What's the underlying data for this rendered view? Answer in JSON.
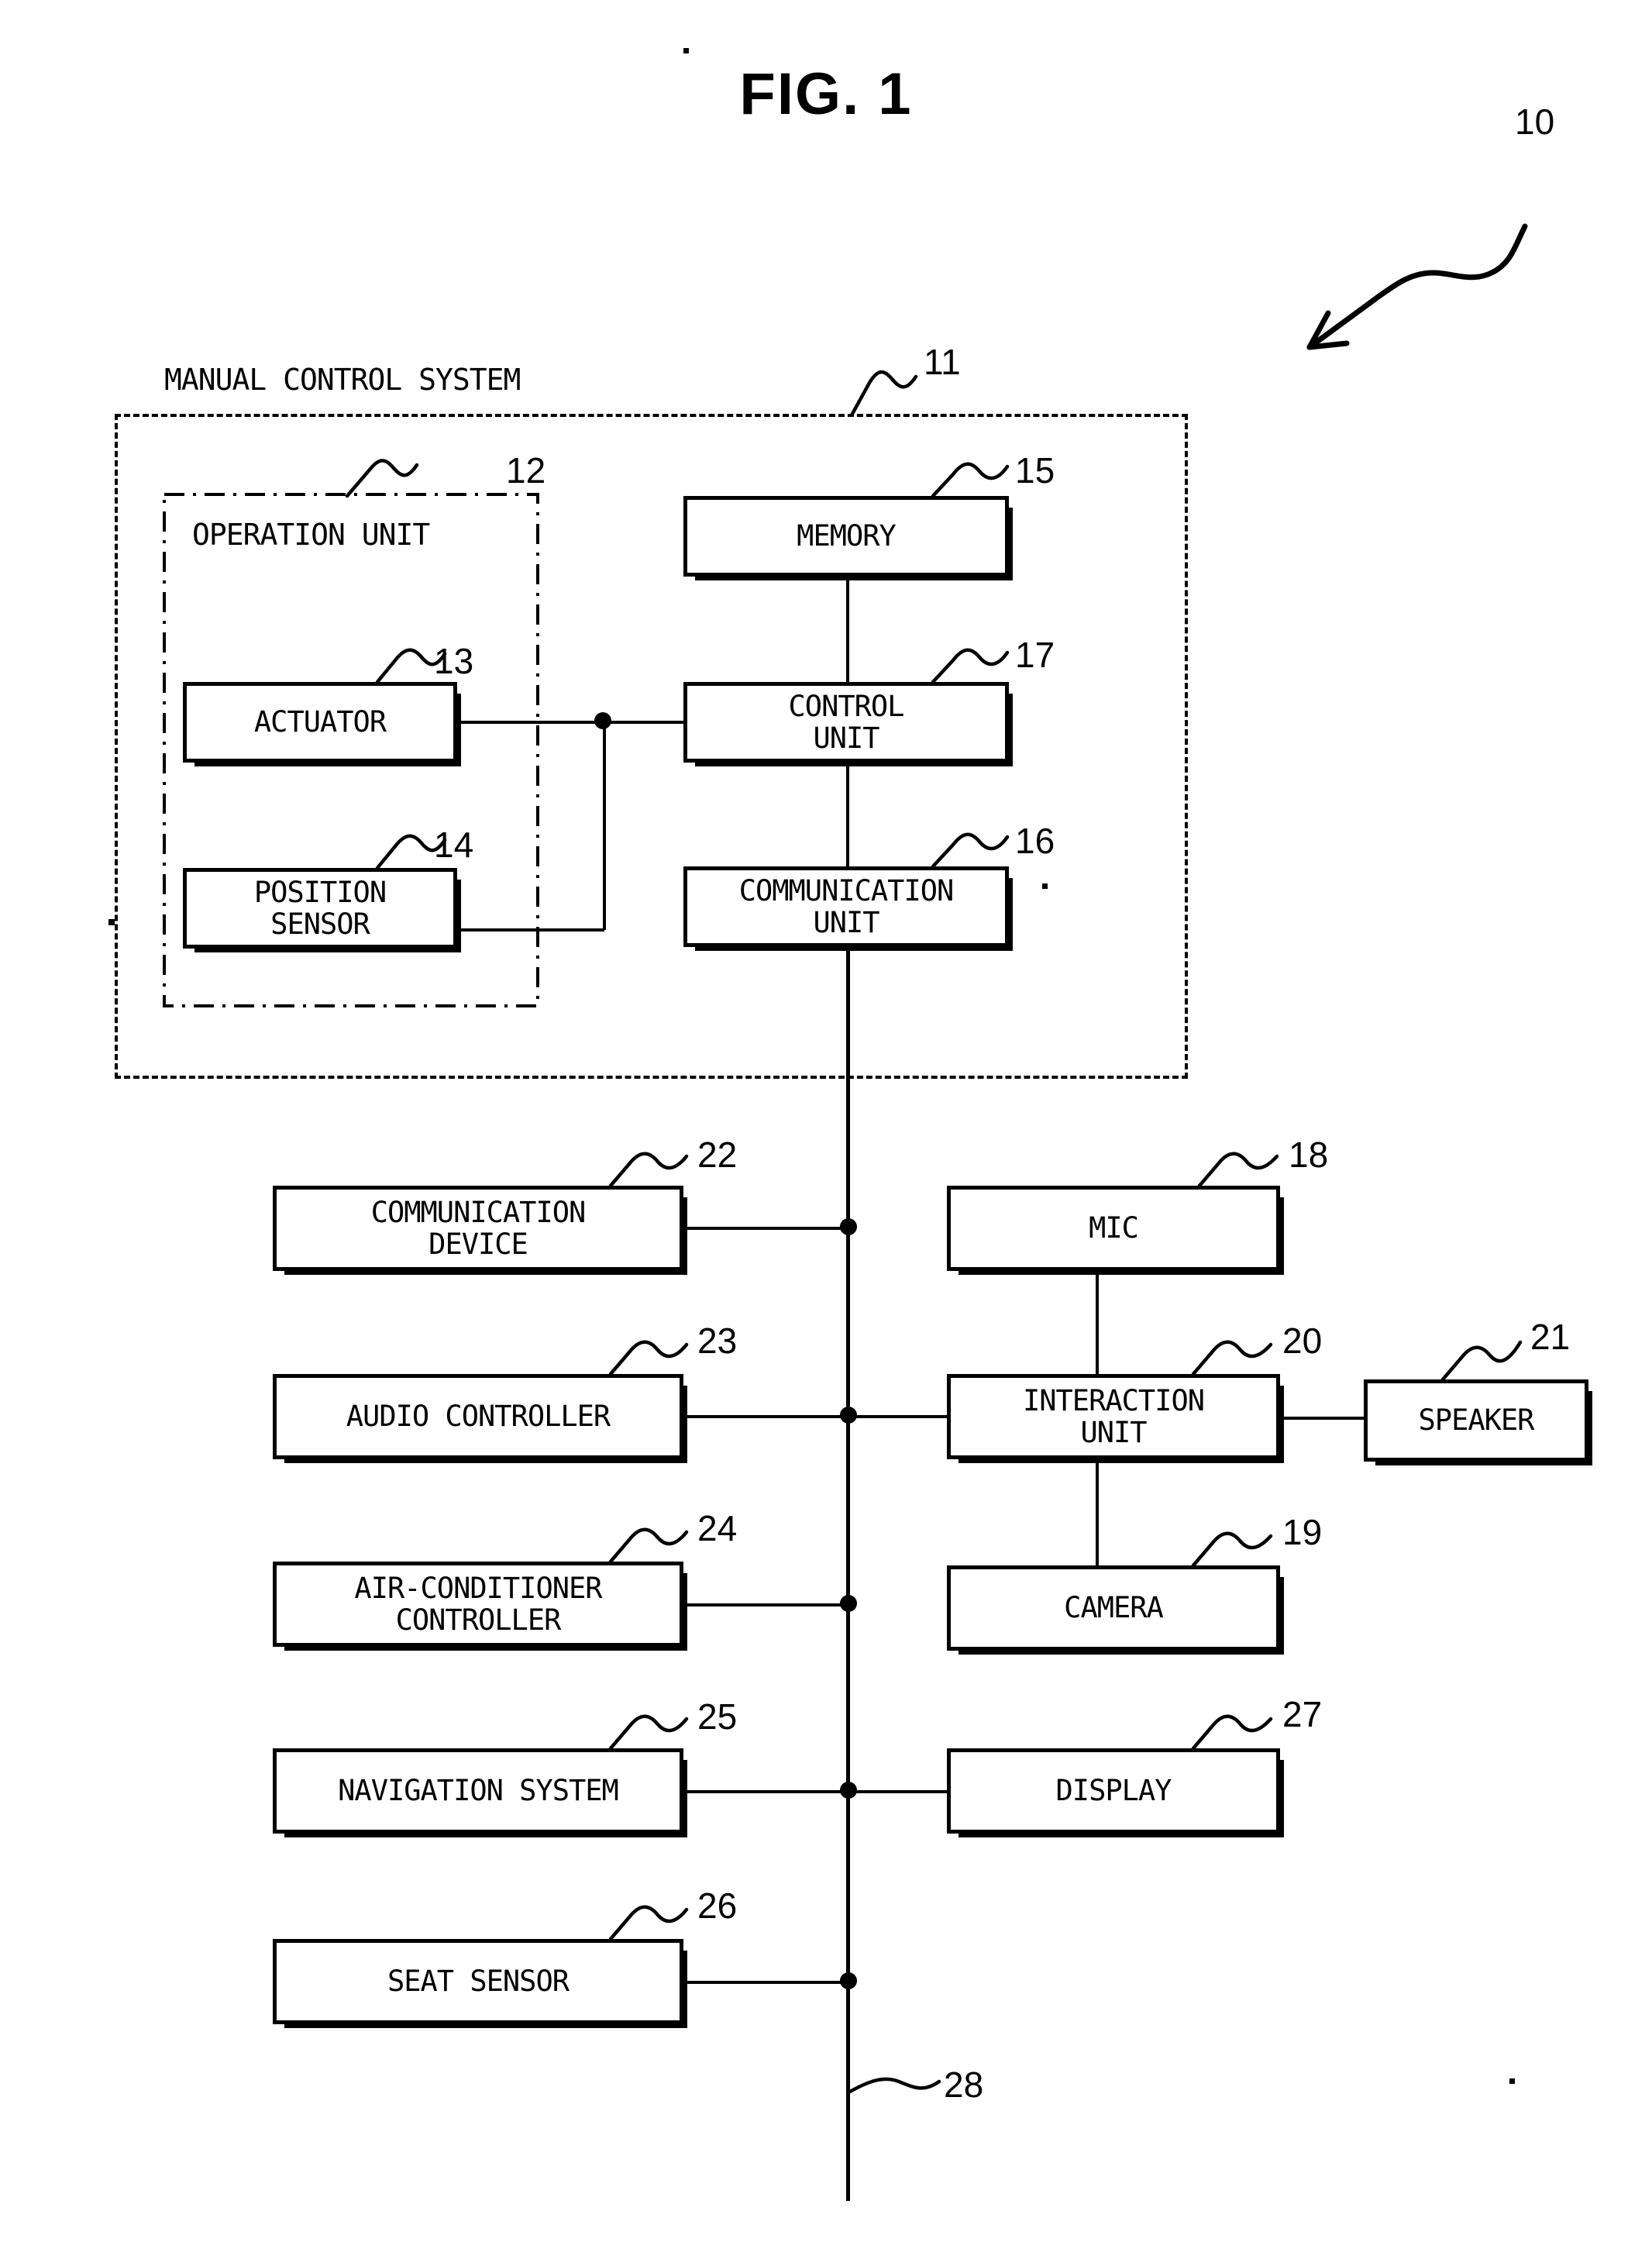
{
  "figure": {
    "title": "FIG. 1",
    "system_ref": "10"
  },
  "enclosures": [
    {
      "name": "manual-control-system",
      "label": "MANUAL CONTROL SYSTEM",
      "ref": "11",
      "style": "dashed"
    },
    {
      "name": "operation-unit",
      "label": "OPERATION UNIT",
      "ref": "12",
      "style": "dash-dot"
    }
  ],
  "blocks": {
    "actuator": {
      "label": "ACTUATOR",
      "ref": "13"
    },
    "position_sensor": {
      "label_line1": "POSITION",
      "label_line2": "SENSOR",
      "ref": "14"
    },
    "memory": {
      "label": "MEMORY",
      "ref": "15"
    },
    "communication_unit": {
      "label_line1": "COMMUNICATION",
      "label_line2": "UNIT",
      "ref": "16"
    },
    "control_unit": {
      "label_line1": "CONTROL",
      "label_line2": "UNIT",
      "ref": "17"
    },
    "mic": {
      "label": "MIC",
      "ref": "18"
    },
    "camera": {
      "label": "CAMERA",
      "ref": "19"
    },
    "interaction_unit": {
      "label_line1": "INTERACTION",
      "label_line2": "UNIT",
      "ref": "20"
    },
    "speaker": {
      "label": "SPEAKER",
      "ref": "21"
    },
    "communication_device": {
      "label_line1": "COMMUNICATION",
      "label_line2": "DEVICE",
      "ref": "22"
    },
    "audio_controller": {
      "label": "AUDIO CONTROLLER",
      "ref": "23"
    },
    "air_conditioner_controller": {
      "label_line1": "AIR-CONDITIONER",
      "label_line2": "CONTROLLER",
      "ref": "24"
    },
    "navigation_system": {
      "label": "NAVIGATION SYSTEM",
      "ref": "25"
    },
    "seat_sensor": {
      "label": "SEAT SENSOR",
      "ref": "26"
    },
    "display": {
      "label": "DISPLAY",
      "ref": "27"
    }
  },
  "bus": {
    "name": "in-vehicle-bus",
    "ref": "28"
  }
}
